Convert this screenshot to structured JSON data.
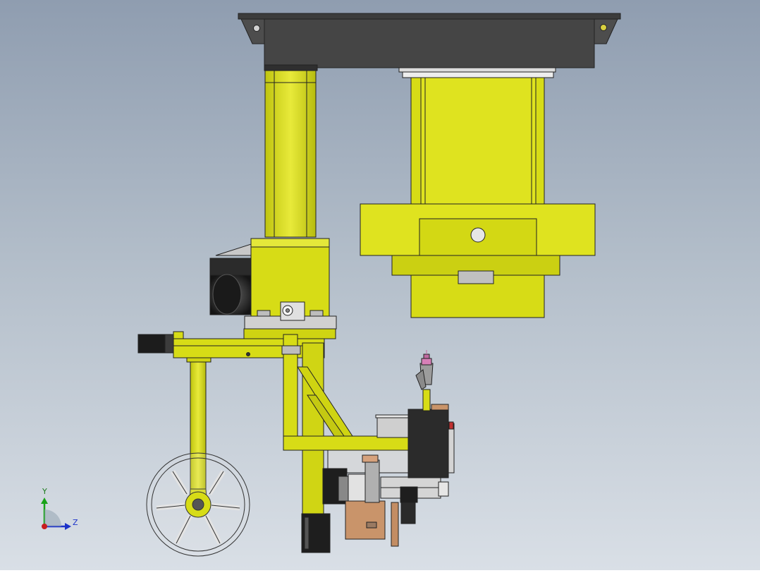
{
  "colors": {
    "bg_top": "#8f9db0",
    "bg_bottom": "#d9dfe6",
    "machine_yellow": "#d7dc16",
    "yellow_shadow": "#c4c912",
    "dark_grey": "#454545",
    "black": "#1e1e1e",
    "copper": "#c9946a",
    "torch_pink": "#d77fb7"
  },
  "triad": {
    "y_label": "Y",
    "z_label": "Z"
  }
}
